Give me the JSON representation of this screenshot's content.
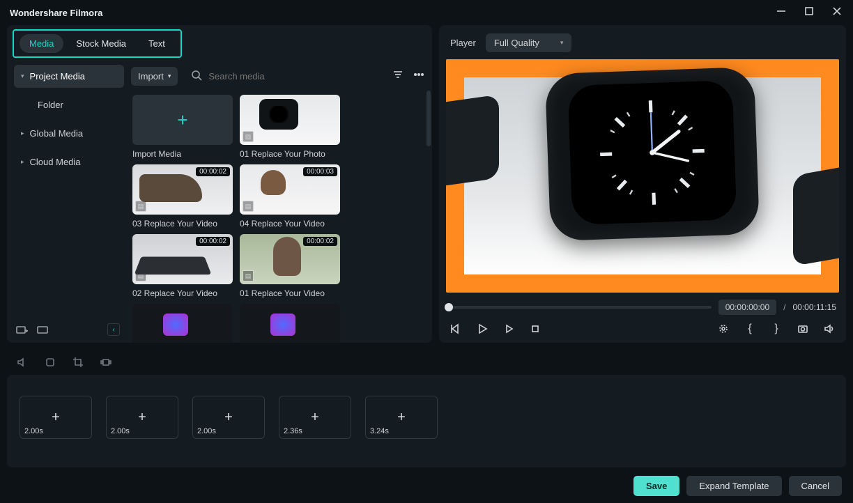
{
  "app_title": "Wondershare Filmora",
  "tabs": {
    "media": "Media",
    "stock": "Stock Media",
    "text": "Text"
  },
  "sidebar": {
    "project_media": "Project Media",
    "folder": "Folder",
    "global_media": "Global Media",
    "cloud_media": "Cloud Media"
  },
  "toolbar": {
    "import": "Import",
    "search_placeholder": "Search media"
  },
  "cards": {
    "import_media": "Import Media",
    "c1": {
      "label": "01 Replace Your Photo"
    },
    "c2": {
      "label": "03 Replace Your Video",
      "dur": "00:00:02"
    },
    "c3": {
      "label": "04 Replace Your Video",
      "dur": "00:00:03"
    },
    "c4": {
      "label": "02 Replace Your Video",
      "dur": "00:00:02"
    },
    "c5": {
      "label": "01 Replace Your Video",
      "dur": "00:00:02"
    }
  },
  "player": {
    "label": "Player",
    "quality": "Full Quality",
    "time_current": "00:00:00:00",
    "time_total": "00:00:11:15",
    "sep": "/"
  },
  "slots": {
    "s1": "2.00s",
    "s2": "2.00s",
    "s3": "2.00s",
    "s4": "2.36s",
    "s5": "3.24s"
  },
  "footer": {
    "save": "Save",
    "expand": "Expand Template",
    "cancel": "Cancel"
  }
}
